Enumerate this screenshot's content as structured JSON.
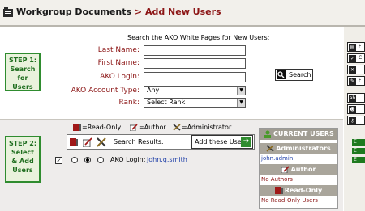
{
  "header": {
    "crumb": "Workgroup Documents",
    "separator": ">",
    "page_title": "Add New Users"
  },
  "step1": {
    "label": "STEP 1:\nSearch\nfor Users",
    "heading": "Search the AKO White Pages for New Users:",
    "fields": {
      "last_name": {
        "label": "Last Name:",
        "value": ""
      },
      "first_name": {
        "label": "First Name:",
        "value": ""
      },
      "ako_login": {
        "label": "AKO Login:",
        "value": ""
      },
      "account_type": {
        "label": "AKO Account Type:",
        "value": "Any"
      },
      "rank": {
        "label": "Rank:",
        "value": "Select Rank"
      }
    },
    "search_button": "Search"
  },
  "step2": {
    "label": "STEP 2:\nSelect\n& Add\nUsers",
    "legend": {
      "read_only": "=Read-Only",
      "author": "=Author",
      "administrator": "=Administrator"
    },
    "results_label": "Search Results:",
    "add_button": "Add these Users",
    "results": [
      {
        "login_label": "AKO Login:",
        "login": "john.q.smith",
        "checked": true,
        "role": "author"
      }
    ]
  },
  "current_users": {
    "title": "CURRENT USERS",
    "administrators_label": "Administrators",
    "administrators": [
      "john.admin"
    ],
    "author_label": "Author",
    "authors_none": "No Authors",
    "read_only_label": "Read-Only",
    "read_only_none": "No Read-Only Users"
  },
  "colors": {
    "accent_red": "#8b1414",
    "step_green": "#2f8c2f",
    "link_blue": "#1f3fa8",
    "panel_gray": "#a09c92"
  }
}
